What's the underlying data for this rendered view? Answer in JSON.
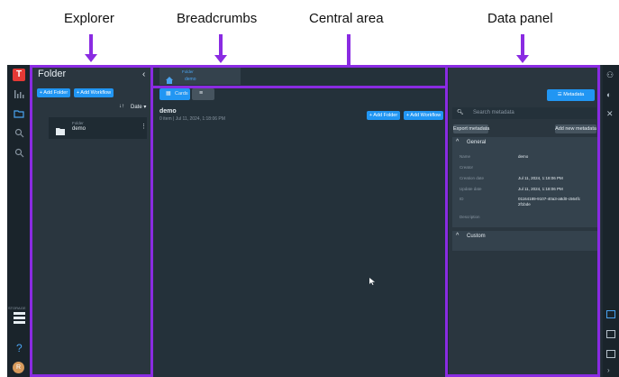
{
  "callouts": {
    "explorer": "Explorer",
    "breadcrumbs": "Breadcrumbs",
    "central": "Central area",
    "datapanel": "Data panel"
  },
  "app": {
    "logo_letter": "T",
    "storage_label": "STORAGE",
    "help_label": "?",
    "avatar_letter": "R"
  },
  "explorer": {
    "title": "Folder",
    "add_folder": "+ Add Folder",
    "add_workflow": "+ Add Workflow",
    "sort_label": "Date",
    "item_type": "Folder",
    "item_name": "demo"
  },
  "breadcrumb": {
    "parent": "Folder",
    "current": "demo"
  },
  "central": {
    "tab_cards": "Cards",
    "title": "demo",
    "meta": "0 item  |  Jul 11, 2024, 1:18:06 PM",
    "add_folder": "+ Add Folder",
    "add_workflow": "+ Add Workflow"
  },
  "datapanel": {
    "metadata_button": "Metadata",
    "search_placeholder": "Search metadata",
    "export_button": "Export metadata",
    "add_button": "Add new metadata",
    "general_header": "General",
    "fields": [
      {
        "label": "Name",
        "value": "demo"
      },
      {
        "label": "Creator",
        "value": ""
      },
      {
        "label": "Creation date",
        "value": "Jul 11, 2024, 1:18:06 PM"
      },
      {
        "label": "Update date",
        "value": "Jul 11, 2024, 1:18:06 PM"
      },
      {
        "label": "ID",
        "value": "01164189-9107-40a3-a8d0-c564fc2f1bde"
      },
      {
        "label": "Description",
        "value": ""
      }
    ],
    "custom_header": "Custom"
  },
  "colors": {
    "annotation": "#8a2be2",
    "accent": "#2196f3",
    "app_bg": "#1f2b33",
    "logo": "#e53935"
  }
}
